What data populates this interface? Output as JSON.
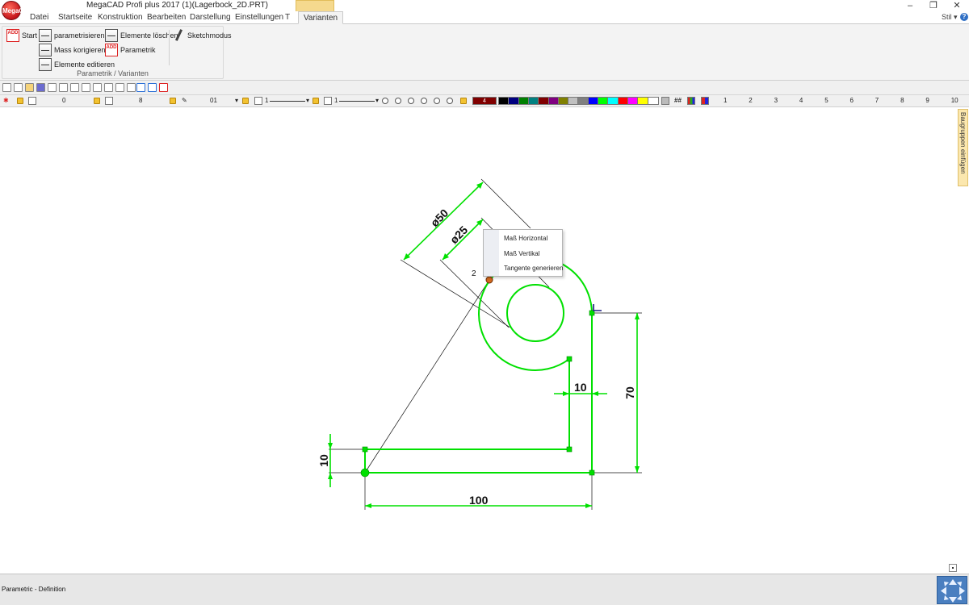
{
  "window": {
    "title": "MegaCAD Profi plus 2017  (1)(Lagerbock_2D.PRT)",
    "logo_text": "MegaCAD",
    "controls": {
      "minimize": "–",
      "restore": "❐",
      "close": "✕"
    }
  },
  "menu": {
    "tabs": [
      "Datei",
      "Startseite",
      "Konstruktion",
      "Bearbeiten",
      "Darstellung",
      "Einstellungen",
      "T",
      "Varianten"
    ],
    "active_tab": "Varianten",
    "style_label": "Stil",
    "style_arrow": "▾",
    "help": "?"
  },
  "ribbon": {
    "group_label": "Parametrik / Varianten",
    "buttons": {
      "start": "Start",
      "parametrisieren": "parametrisieren",
      "mass_korrigieren": "Mass korigieren",
      "elemente_editieren": "Elemente editieren",
      "elemente_loeschen": "Elemente löschen",
      "parametrik": "Parametrik",
      "sketchmodus": "Sketchmodus"
    }
  },
  "toolbar2": {
    "layer_value": "0",
    "group_value": "8",
    "pen_value": "01",
    "line_width_1": "1",
    "line_width_2": "1",
    "color_value": "4",
    "hash_label": "##",
    "numbers": [
      "1",
      "2",
      "3",
      "4",
      "5",
      "6",
      "7",
      "8",
      "9",
      "10"
    ],
    "swatch_colors": [
      "#000000",
      "#000080",
      "#008000",
      "#008080",
      "#800000",
      "#800080",
      "#808000",
      "#c0c0c0",
      "#808080",
      "#0000ff",
      "#00ff00",
      "#00ffff",
      "#ff0000",
      "#ff00ff",
      "#ffff00",
      "#ffffff"
    ],
    "color_value_bg": "#800000"
  },
  "drawing": {
    "dimensions": {
      "d50": "ø50",
      "d25": "ø25",
      "w10_top": "10",
      "h70": "70",
      "h10_left": "10",
      "w100": "100"
    },
    "node_label": "2",
    "geometry_color": "#00e000"
  },
  "context_menu": {
    "items": [
      "Maß Horizontal",
      "Maß Vertikal",
      "Tangente generieren"
    ]
  },
  "side_panel": {
    "tab_label": "Baugruppen einfügen"
  },
  "status": {
    "text": "Parametric - Definition"
  }
}
